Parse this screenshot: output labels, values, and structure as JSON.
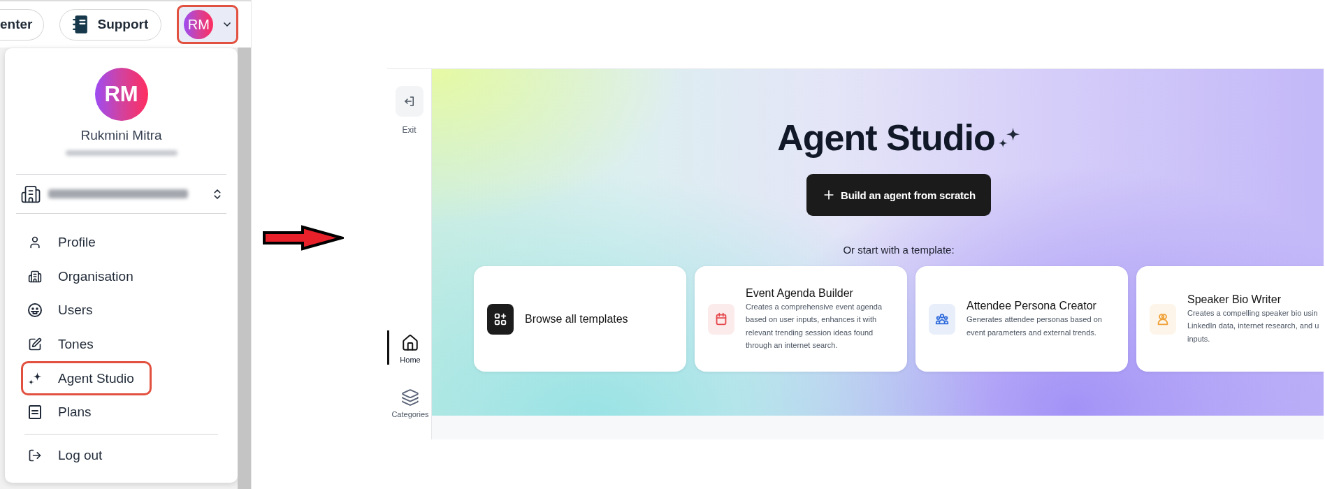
{
  "left_screen": {
    "top_bar": {
      "partial_button": {
        "label": "enter"
      },
      "support_button": {
        "label": "Support"
      },
      "account_button": {
        "initials": "RM",
        "highlighted": true
      }
    },
    "account_menu": {
      "avatar_initials": "RM",
      "name": "Rukmini Mitra",
      "email_blurred": true,
      "organisation_selector": {
        "name_blurred": true
      },
      "items": [
        {
          "kind": "profile",
          "label": "Profile",
          "highlighted": false
        },
        {
          "kind": "organisation",
          "label": "Organisation",
          "highlighted": false
        },
        {
          "kind": "users",
          "label": "Users",
          "highlighted": false
        },
        {
          "kind": "tones",
          "label": "Tones",
          "highlighted": false
        },
        {
          "kind": "agent_studio",
          "label": "Agent Studio",
          "highlighted": true
        },
        {
          "kind": "plans",
          "label": "Plans",
          "highlighted": false
        }
      ],
      "bottom_items": [
        {
          "kind": "logout",
          "label": "Log out",
          "highlighted": false
        }
      ]
    }
  },
  "right_screen": {
    "sidebar": {
      "exit_button": {
        "label": "Exit"
      },
      "nav_items": [
        {
          "kind": "home",
          "label": "Home",
          "selected": true
        },
        {
          "kind": "categories",
          "label": "Categories",
          "selected": false
        }
      ]
    },
    "hero": {
      "title": "Agent Studio",
      "build_button": {
        "label": "Build an agent from scratch"
      },
      "subtitle": "Or start with a template:"
    },
    "template_cards": [
      {
        "kind": "browse",
        "title": "Browse all templates",
        "color": "#1c1c1c"
      },
      {
        "kind": "calendar",
        "title": "Event Agenda Builder",
        "color": "#e5484d",
        "description": [
          "Creates a comprehensive event agenda",
          "based on user inputs, enhances it with",
          "relevant trending session ideas found",
          "through an internet search."
        ]
      },
      {
        "kind": "group",
        "title": "Attendee Persona Creator",
        "color": "#2f6bdc",
        "description": [
          "Generates attendee personas based on",
          "event parameters and external trends."
        ]
      },
      {
        "kind": "pair",
        "title": "Speaker Bio Writer",
        "color": "#f0a23a",
        "description": [
          "Creates a compelling speaker bio usin",
          "LinkedIn data, internet research, and u",
          "inputs."
        ]
      }
    ]
  }
}
